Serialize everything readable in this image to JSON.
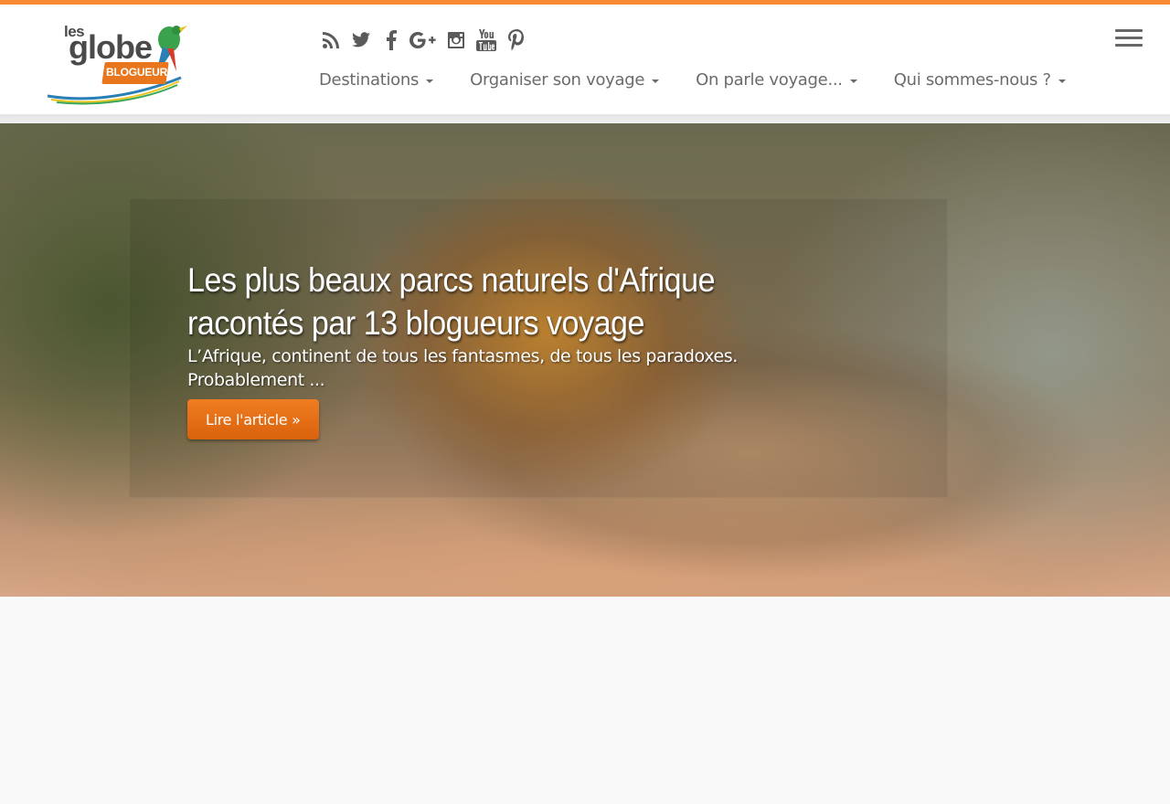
{
  "brand": {
    "logo_small": "les",
    "logo_main": "globe",
    "logo_badge": "BLOGUEURS",
    "accent_color": "#f68b33"
  },
  "social": [
    {
      "icon": "rss-icon"
    },
    {
      "icon": "twitter-icon"
    },
    {
      "icon": "facebook-icon"
    },
    {
      "icon": "google-plus-icon"
    },
    {
      "icon": "instagram-icon"
    },
    {
      "icon": "youtube-icon"
    },
    {
      "icon": "pinterest-icon"
    }
  ],
  "nav": {
    "items": [
      {
        "label": "Destinations"
      },
      {
        "label": "Organiser son voyage"
      },
      {
        "label": "On parle voyage..."
      },
      {
        "label": "Qui sommes-nous ?"
      }
    ]
  },
  "hero": {
    "title": "Les plus beaux parcs naturels d'Afrique racontés par 13 blogueurs voyage",
    "excerpt": "L’Afrique, continent de tous les fantasmes, de tous les paradoxes. Probablement ...",
    "button_label": "Lire l'article »"
  }
}
